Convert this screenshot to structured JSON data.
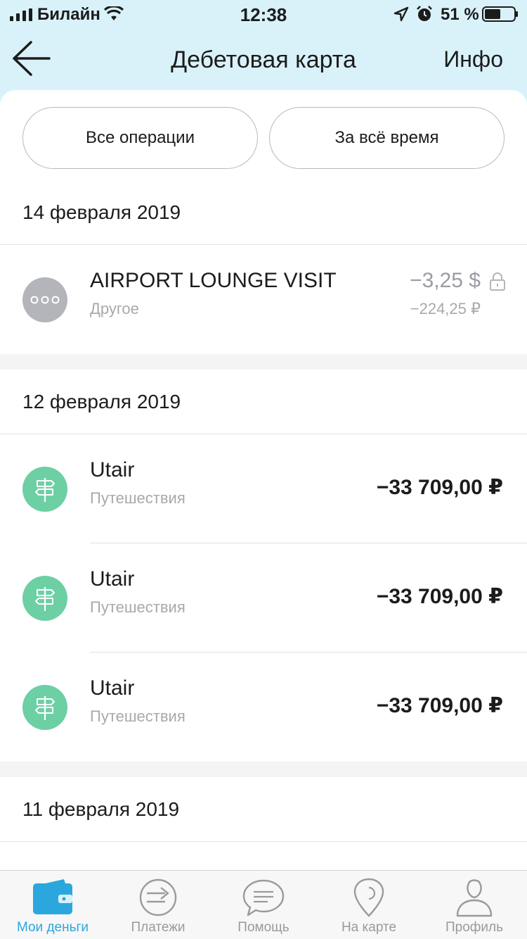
{
  "status_bar": {
    "carrier": "Билайн",
    "time": "12:38",
    "battery": "51 %"
  },
  "nav": {
    "title": "Дебетовая карта",
    "info": "Инфо"
  },
  "filters": {
    "operations": "Все операции",
    "period": "За всё время"
  },
  "groups": [
    {
      "date": "14 февраля 2019",
      "transactions": [
        {
          "name": "AIRPORT LOUNGE VISIT",
          "category": "Другое",
          "amount": "−3,25 $",
          "amount_alt": "−224,25 ₽",
          "icon": "dots-icon",
          "pending": true
        }
      ]
    },
    {
      "date": "12 февраля 2019",
      "transactions": [
        {
          "name": "Utair",
          "category": "Путешествия",
          "amount": "−33 709,00 ₽",
          "icon": "signpost-icon"
        },
        {
          "name": "Utair",
          "category": "Путешествия",
          "amount": "−33 709,00 ₽",
          "icon": "signpost-icon"
        },
        {
          "name": "Utair",
          "category": "Путешествия",
          "amount": "−33 709,00 ₽",
          "icon": "signpost-icon"
        }
      ]
    },
    {
      "date": "11 февраля 2019",
      "transactions": []
    }
  ],
  "tabs": [
    {
      "label": "Мои деньги",
      "icon": "wallet-icon",
      "active": true
    },
    {
      "label": "Платежи",
      "icon": "arrow-circle-icon"
    },
    {
      "label": "Помощь",
      "icon": "chat-bubble-icon"
    },
    {
      "label": "На карте",
      "icon": "map-pin-icon"
    },
    {
      "label": "Профиль",
      "icon": "person-icon"
    }
  ],
  "colors": {
    "header_bg": "#d9f2fa",
    "accent": "#2ba7dd",
    "travel_green": "#6dcfa4",
    "other_grey": "#b3b5bb"
  }
}
